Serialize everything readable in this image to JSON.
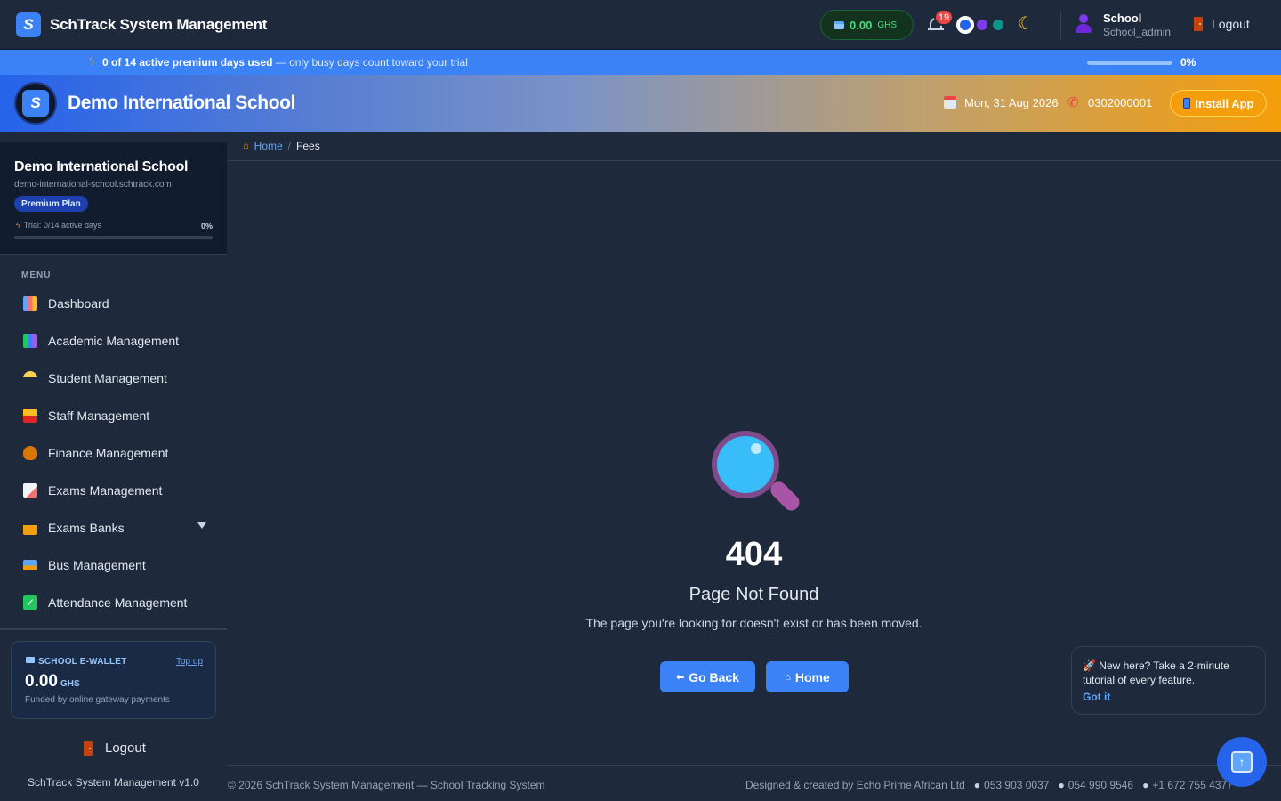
{
  "app": {
    "title": "SchTrack System Management",
    "logo_letter": "S"
  },
  "topbar": {
    "wallet_amount": "0.00",
    "wallet_currency": "GHS",
    "notification_count": "19",
    "user_name": "School",
    "user_role": "School_admin",
    "logout_label": "Logout"
  },
  "trial_banner": {
    "bold": "0 of 14 active premium days used",
    "rest": " — only busy days count toward your trial",
    "progress_percent": 0,
    "percent_label": "0%"
  },
  "school_header": {
    "name": "Demo International School",
    "date": "Mon, 31 Aug 2026",
    "phone": "0302000001",
    "install_label": "Install App"
  },
  "sidebar": {
    "school_name": "Demo International School",
    "school_url": "demo-international-school.schtrack.com",
    "plan": "Premium Plan",
    "trial_text": "Trial: 0/14 active days",
    "trial_pct": "0%",
    "menu_label": "MENU",
    "items": [
      {
        "label": "Dashboard",
        "icon": "bar-chart-icon"
      },
      {
        "label": "Academic Management",
        "icon": "books-icon"
      },
      {
        "label": "Student Management",
        "icon": "student-icon"
      },
      {
        "label": "Staff Management",
        "icon": "staff-icon"
      },
      {
        "label": "Finance Management",
        "icon": "money-bag-icon"
      },
      {
        "label": "Exams Management",
        "icon": "exam-paper-icon"
      },
      {
        "label": "Exams Banks",
        "icon": "crown-icon"
      },
      {
        "label": "Bus Management",
        "icon": "bus-icon"
      },
      {
        "label": "Attendance Management",
        "icon": "check-box-icon"
      }
    ],
    "ewallet": {
      "title": "SCHOOL E-WALLET",
      "topup": "Top up",
      "amount": "0.00",
      "currency": "GHS",
      "note": "Funded by online gateway payments"
    },
    "logout_label": "Logout",
    "version": "SchTrack System Management v1.0"
  },
  "breadcrumb": {
    "home": "Home",
    "separator": "/",
    "current": "Fees"
  },
  "error_page": {
    "code": "404",
    "title": "Page Not Found",
    "message": "The page you're looking for doesn't exist or has been moved.",
    "back_label": "Go Back",
    "home_label": "Home"
  },
  "tour_popup": {
    "text": "🚀 New here? Take a 2-minute tutorial of every feature.",
    "got_it": "Got it"
  },
  "footer": {
    "copyright": "© 2026 SchTrack System Management — School Tracking System",
    "credit": "Designed & created by Echo Prime African Ltd",
    "phone1": "053 903 0037",
    "phone2": "054 990 9546",
    "phone3": "+1 672 755 4377"
  },
  "colors": {
    "accent": "#3b82f6",
    "background": "#1e293b",
    "success": "#4ade80",
    "danger": "#ef4444",
    "warning": "#f59e0b"
  }
}
